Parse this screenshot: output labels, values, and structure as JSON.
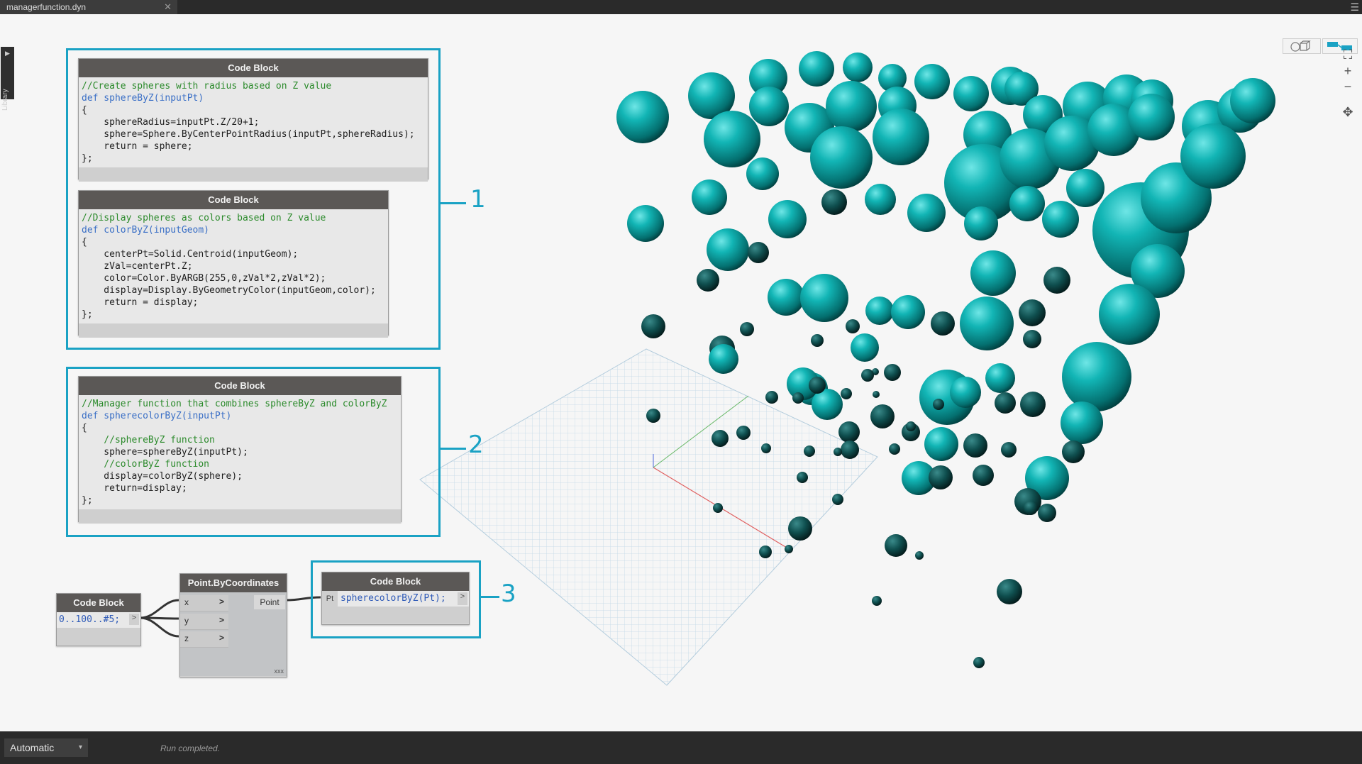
{
  "tab": {
    "title": "managerfunction.dyn",
    "close_glyph": "✕"
  },
  "library": {
    "label": "Library",
    "arrow": "▶"
  },
  "nodes": {
    "code1": {
      "title": "Code Block",
      "lines": [
        "//Create spheres with radius based on Z value",
        "def sphereByZ(inputPt)",
        "{",
        "    sphereRadius=inputPt.Z/20+1;",
        "    sphere=Sphere.ByCenterPointRadius(inputPt,sphereRadius);",
        "    return = sphere;",
        "};"
      ]
    },
    "code2": {
      "title": "Code Block",
      "lines": [
        "//Display spheres as colors based on Z value",
        "def colorByZ(inputGeom)",
        "{",
        "    centerPt=Solid.Centroid(inputGeom);",
        "    zVal=centerPt.Z;",
        "    color=Color.ByARGB(255,0,zVal*2,zVal*2);",
        "    display=Display.ByGeometryColor(inputGeom,color);",
        "    return = display;",
        "};"
      ]
    },
    "code3": {
      "title": "Code Block",
      "lines": [
        "//Manager function that combines sphereByZ and colorByZ",
        "def spherecolorByZ(inputPt)",
        "{",
        "    //sphereByZ function",
        "    sphere=sphereByZ(inputPt);",
        "    //colorByZ function",
        "    display=colorByZ(sphere);",
        "    return=display;",
        "};"
      ]
    },
    "range": {
      "title": "Code Block",
      "code": "0..100..#5;",
      "out_glyph": ">"
    },
    "point": {
      "title": "Point.ByCoordinates",
      "inputs": [
        "x",
        "y",
        "z"
      ],
      "output": "Point",
      "lacing": "xxx",
      "port_glyph": ">"
    },
    "call": {
      "title": "Code Block",
      "input": "Pt",
      "code": "spherecolorByZ(Pt);",
      "out_glyph": ">"
    }
  },
  "callouts": [
    "1",
    "2",
    "3"
  ],
  "nav": {
    "fit": "⛶",
    "zoom_in": "+",
    "zoom_out": "−",
    "pan": "✥"
  },
  "status": {
    "run_mode": "Automatic",
    "run_mode_arrow": "▾",
    "message": "Run completed."
  },
  "menu_glyph": "☰",
  "colors": {
    "accent": "#1aa2c4",
    "sphere": "#009c9c",
    "node_header": "#5b5856"
  }
}
